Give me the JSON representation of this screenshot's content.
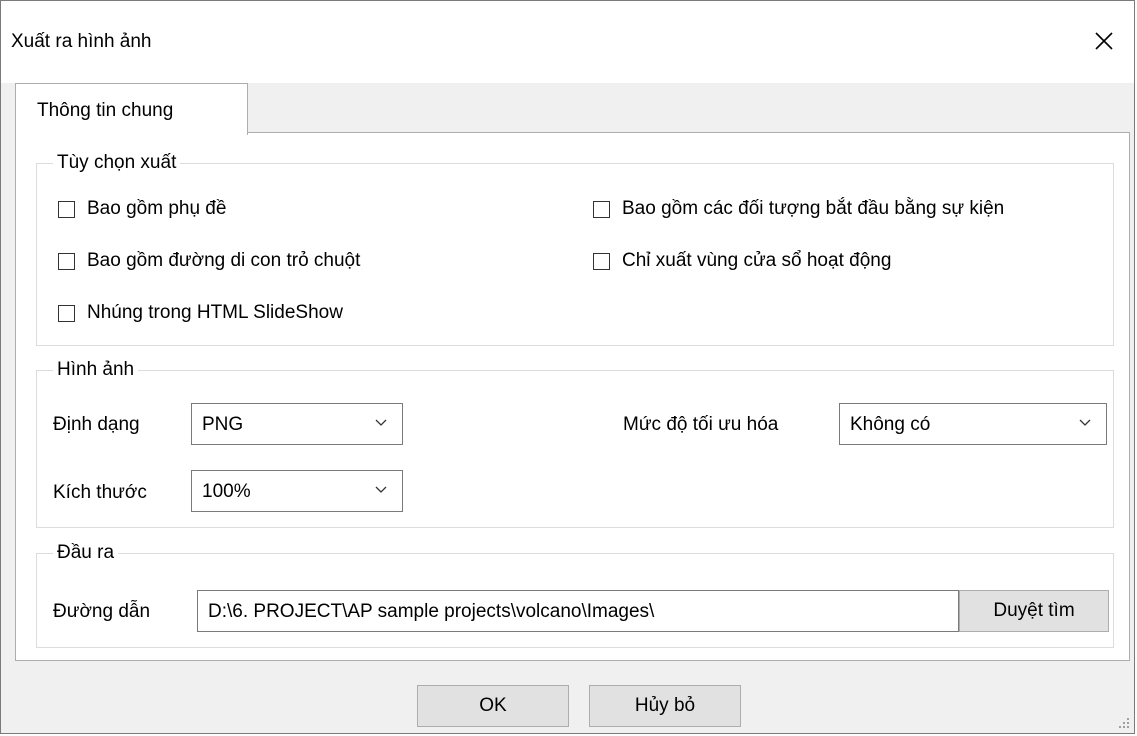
{
  "window": {
    "title": "Xuất ra hình ảnh"
  },
  "tabs": [
    {
      "label": "Thông tin chung"
    }
  ],
  "export_options": {
    "group_label": "Tùy chọn xuất",
    "checkboxes": [
      {
        "label": "Bao gồm phụ đề",
        "checked": false
      },
      {
        "label": "Bao gồm các đối tượng bắt đầu bằng sự kiện",
        "checked": false
      },
      {
        "label": "Bao gồm đường di con trỏ chuột",
        "checked": false
      },
      {
        "label": "Chỉ xuất vùng cửa sổ hoạt động",
        "checked": false
      },
      {
        "label": "Nhúng trong HTML SlideShow",
        "checked": false
      }
    ]
  },
  "image": {
    "group_label": "Hình ảnh",
    "format_label": "Định dạng",
    "format_value": "PNG",
    "optimization_label": "Mức độ tối ưu hóa",
    "optimization_value": "Không có",
    "size_label": "Kích thước",
    "size_value": "100%"
  },
  "output": {
    "group_label": "Đầu ra",
    "path_label": "Đường dẫn",
    "path_value": "D:\\6. PROJECT\\AP sample projects\\volcano\\Images\\",
    "browse_label": "Duyệt tìm"
  },
  "footer": {
    "ok_label": "OK",
    "cancel_label": "Hủy bỏ"
  }
}
